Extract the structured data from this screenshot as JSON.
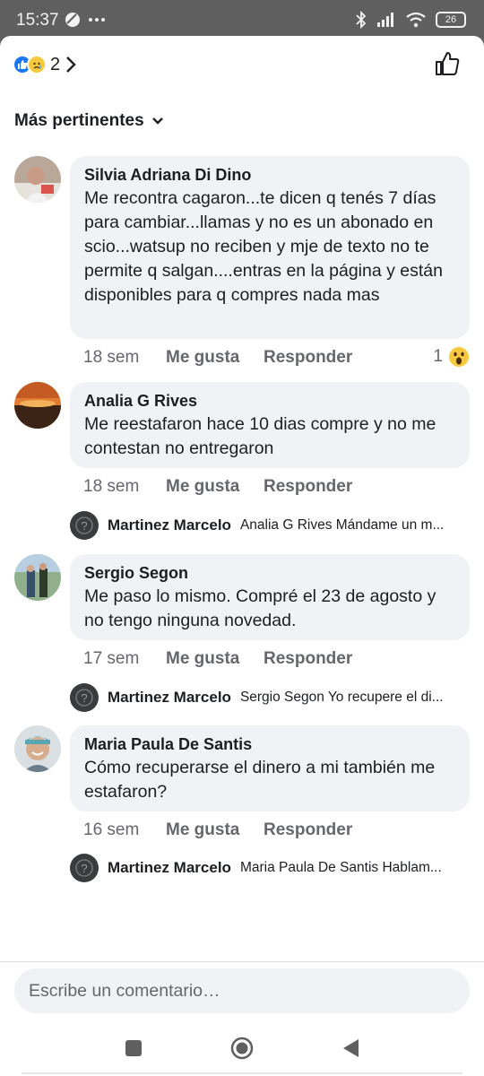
{
  "status_bar": {
    "time": "15:37",
    "battery": "26"
  },
  "reactions": {
    "count": "2",
    "icons": [
      "like-icon",
      "sad-icon"
    ]
  },
  "sort": {
    "label": "Más pertinentes"
  },
  "comments": [
    {
      "author": "Silvia Adriana Di Dino",
      "text": "Me recontra cagaron...te dicen q tenés 7 días para cambiar...llamas y no es un abonado en scio...watsup no reciben y mje de texto no te permite q salgan....entras en la página y están disponibles para q compres nada mas",
      "time": "18 sem",
      "like": "Me gusta",
      "reply": "Responder",
      "reaction_count": "1"
    },
    {
      "author": "Analia G Rives",
      "text": "Me reestafaron hace 10 dias compre y no me contestan no entregaron",
      "time": "18 sem",
      "like": "Me gusta",
      "reply": "Responder",
      "replies": [
        {
          "author": "Martinez Marcelo",
          "text": "Analia G Rives Mándame un m..."
        }
      ]
    },
    {
      "author": "Sergio Segon",
      "text": "Me paso lo mismo.  Compré el 23 de agosto y no tengo ninguna novedad.",
      "time": "17 sem",
      "like": "Me gusta",
      "reply": "Responder",
      "replies": [
        {
          "author": "Martinez Marcelo",
          "text": "Sergio Segon Yo recupere el di..."
        }
      ]
    },
    {
      "author": "Maria Paula De Santis",
      "text": "Cómo recuperarse el dinero a mi también me estafaron?",
      "time": "16 sem",
      "like": "Me gusta",
      "reply": "Responder",
      "replies": [
        {
          "author": "Martinez Marcelo",
          "text": "Maria Paula De Santis Hablam..."
        }
      ]
    }
  ],
  "composer": {
    "placeholder": "Escribe un comentario…"
  },
  "colors": {
    "like_blue": "#1877f2",
    "muted_text": "#65676b",
    "bubble_bg": "#f0f2f5"
  }
}
